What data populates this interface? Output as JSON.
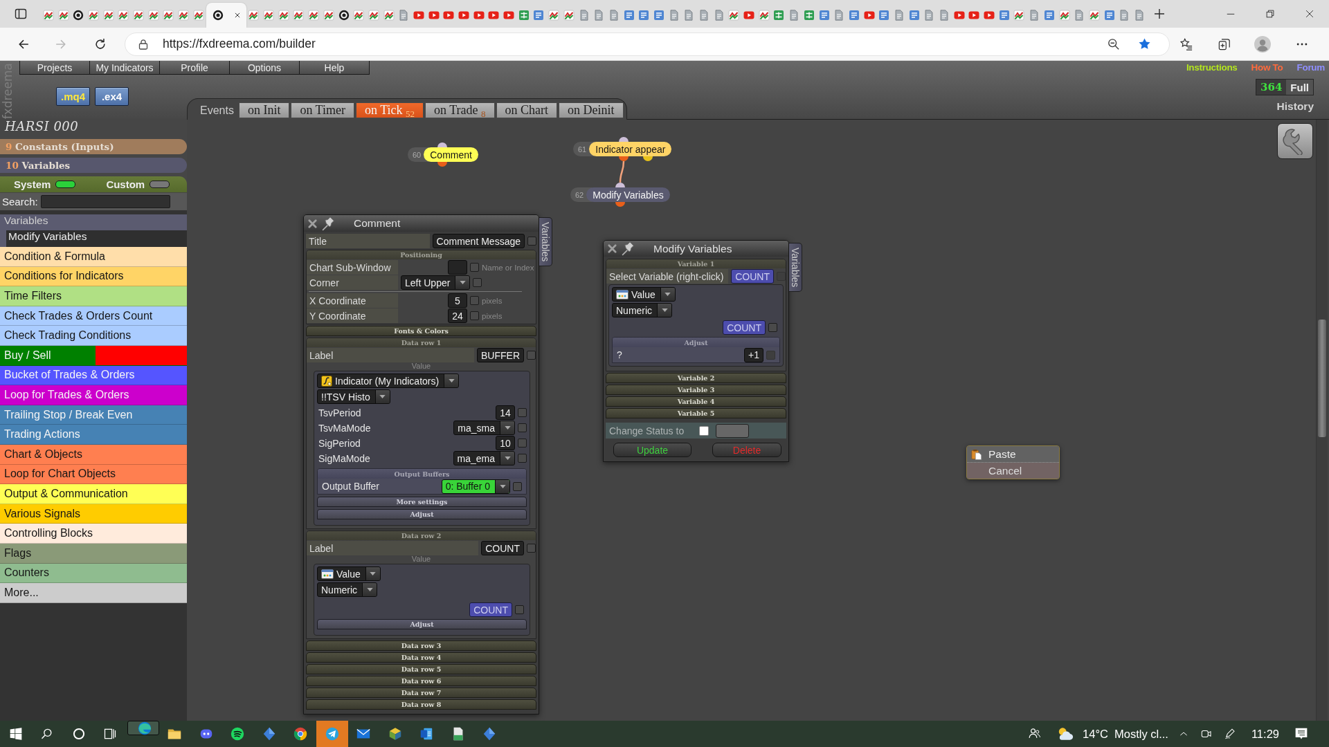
{
  "browser": {
    "tabs": [
      {
        "kind": "zigzag",
        "selected": false
      },
      {
        "kind": "zigzag",
        "selected": false
      },
      {
        "kind": "ring",
        "selected": false
      },
      {
        "kind": "zigzag",
        "selected": false
      },
      {
        "kind": "zigzag",
        "selected": false
      },
      {
        "kind": "zigzag",
        "selected": false
      },
      {
        "kind": "zigzag",
        "selected": false
      },
      {
        "kind": "zigzag",
        "selected": false
      },
      {
        "kind": "zigzag",
        "selected": false
      },
      {
        "kind": "zigzag",
        "selected": false
      },
      {
        "kind": "zigzag",
        "selected": false
      },
      {
        "kind": "ring",
        "selected": true
      },
      {
        "kind": "zigzag",
        "selected": false
      },
      {
        "kind": "zigzag",
        "selected": false
      },
      {
        "kind": "zigzag",
        "selected": false
      },
      {
        "kind": "zigzag",
        "selected": false
      },
      {
        "kind": "zigzag",
        "selected": false
      },
      {
        "kind": "zigzag",
        "selected": false
      },
      {
        "kind": "ring",
        "selected": false
      },
      {
        "kind": "zigzag",
        "selected": false
      },
      {
        "kind": "zigzag",
        "selected": false
      },
      {
        "kind": "zigzag",
        "selected": false
      },
      {
        "kind": "page",
        "selected": false
      },
      {
        "kind": "play",
        "selected": false
      },
      {
        "kind": "play",
        "selected": false
      },
      {
        "kind": "play",
        "selected": false
      },
      {
        "kind": "play",
        "selected": false
      },
      {
        "kind": "play",
        "selected": false
      },
      {
        "kind": "play",
        "selected": false
      },
      {
        "kind": "play",
        "selected": false
      },
      {
        "kind": "table",
        "selected": false
      },
      {
        "kind": "list",
        "selected": false
      },
      {
        "kind": "zigzag",
        "selected": false
      },
      {
        "kind": "zigzag",
        "selected": false
      },
      {
        "kind": "page",
        "selected": false
      },
      {
        "kind": "page",
        "selected": false
      },
      {
        "kind": "page",
        "selected": false
      },
      {
        "kind": "list",
        "selected": false
      },
      {
        "kind": "list",
        "selected": false
      },
      {
        "kind": "list",
        "selected": false
      },
      {
        "kind": "page",
        "selected": false
      },
      {
        "kind": "page",
        "selected": false
      },
      {
        "kind": "page",
        "selected": false
      },
      {
        "kind": "page",
        "selected": false
      },
      {
        "kind": "zigzag",
        "selected": false
      },
      {
        "kind": "play",
        "selected": false
      },
      {
        "kind": "zigzag",
        "selected": false
      },
      {
        "kind": "table",
        "selected": false
      },
      {
        "kind": "page",
        "selected": false
      },
      {
        "kind": "table",
        "selected": false
      },
      {
        "kind": "list",
        "selected": false
      },
      {
        "kind": "page",
        "selected": false
      },
      {
        "kind": "list",
        "selected": false
      },
      {
        "kind": "play",
        "selected": false
      },
      {
        "kind": "list",
        "selected": false
      },
      {
        "kind": "page",
        "selected": false
      },
      {
        "kind": "list",
        "selected": false
      },
      {
        "kind": "page",
        "selected": false
      },
      {
        "kind": "page",
        "selected": false
      },
      {
        "kind": "play",
        "selected": false
      },
      {
        "kind": "play",
        "selected": false
      },
      {
        "kind": "play",
        "selected": false
      },
      {
        "kind": "list",
        "selected": false
      },
      {
        "kind": "zigzag",
        "selected": false
      },
      {
        "kind": "page",
        "selected": false
      },
      {
        "kind": "list",
        "selected": false
      },
      {
        "kind": "zigzag",
        "selected": false
      },
      {
        "kind": "page",
        "selected": false
      },
      {
        "kind": "zigzag",
        "selected": false
      },
      {
        "kind": "list",
        "selected": false
      },
      {
        "kind": "page",
        "selected": false
      },
      {
        "kind": "page",
        "selected": false
      }
    ],
    "url": "https://fxdreema.com/builder",
    "bookmarked": true
  },
  "app": {
    "brand": "fxdreema",
    "menu": [
      "Projects",
      "My Indicators",
      "Profile",
      "Options",
      "Help"
    ],
    "file_buttons": [
      {
        "label": ".mq4",
        "selected": true
      },
      {
        "label": ".ex4",
        "selected": false
      }
    ],
    "links": [
      {
        "label": "Instructions",
        "color": "#b4e61e"
      },
      {
        "label": "How To",
        "color": "#ff6a3c"
      },
      {
        "label": "Forum",
        "color": "#8f8fff"
      }
    ],
    "history": {
      "count": "364",
      "mode": "Full",
      "label": "History"
    },
    "events": {
      "label": "Events",
      "tabs": [
        {
          "label": "on Init",
          "selected": false
        },
        {
          "label": "on Timer",
          "selected": false
        },
        {
          "label": "on Tick",
          "count": "52",
          "selected": true
        },
        {
          "label": "on Trade",
          "count": "8",
          "selected": false
        },
        {
          "label": "on Chart",
          "selected": false
        },
        {
          "label": "on Deinit",
          "selected": false
        }
      ]
    }
  },
  "sidebar": {
    "project": "HARSI 000",
    "groups": [
      {
        "count": "9",
        "label": "Constants (Inputs)",
        "color": "#a07c5c"
      },
      {
        "count": "10",
        "label": "Variables",
        "color": "#57576d"
      }
    ],
    "toggles": [
      {
        "label": "System",
        "on": true
      },
      {
        "label": "Custom",
        "on": false
      }
    ],
    "search": {
      "label": "Search:"
    },
    "section": "Variables",
    "section_items": [
      "Modify Variables"
    ],
    "categories": [
      {
        "label": "Condition & Formula",
        "color": "#ffdeaa"
      },
      {
        "label": "Conditions for Indicators",
        "color": "#ffd466"
      },
      {
        "label": "Time Filters",
        "color": "#b0e084"
      },
      {
        "label": "Check Trades & Orders Count",
        "color": "#aaccff"
      },
      {
        "label": "Check Trading Conditions",
        "color": "#aaccff"
      },
      {
        "label": "Buy / Sell",
        "color": "#008000",
        "split": {
          "color": "#ff0000"
        }
      },
      {
        "label": "Bucket of Trades & Orders",
        "color": "#5555ff"
      },
      {
        "label": "Loop for Trades & Orders",
        "color": "#cc00cc"
      },
      {
        "label": "Trailing Stop / Break Even",
        "color": "#4682b4"
      },
      {
        "label": "Trading Actions",
        "color": "#4682b4"
      },
      {
        "label": "Chart & Objects",
        "color": "#ff7f50"
      },
      {
        "label": "Loop for Chart Objects",
        "color": "#ff7f50"
      },
      {
        "label": "Output & Communication",
        "color": "#ffff55"
      },
      {
        "label": "Various Signals",
        "color": "#ffcc00"
      },
      {
        "label": "Controlling Blocks",
        "color": "#ffebdc"
      },
      {
        "label": "Flags",
        "color": "#8a9a78"
      },
      {
        "label": "Counters",
        "color": "#8fbc8f"
      },
      {
        "label": "More...",
        "color": "#cccccc"
      }
    ]
  },
  "canvas": {
    "nodes": [
      {
        "number": "60",
        "label": "Comment",
        "kind": "action",
        "color": "#ffff55"
      },
      {
        "number": "61",
        "label": "Indicator appear",
        "kind": "condition",
        "color": "#ffd466",
        "children": [
          {
            "number": "62",
            "label": "Modify Variables",
            "kind": "action",
            "color": "#5a5a70"
          }
        ]
      }
    ]
  },
  "comment_panel": {
    "title": "Comment",
    "side_tab": "Variables",
    "title_row": {
      "label": "Title",
      "value": "Comment Message",
      "checked": false
    },
    "sections": [
      {
        "kind": "positioning",
        "heading": "Positioning",
        "expanded": true,
        "groups": [
          [
            {
              "label": "Chart Sub-Window",
              "kind": "input",
              "note": "Name or Index",
              "checked": false
            },
            {
              "label": "Corner",
              "kind": "select",
              "value": "Left Upper",
              "checked": false
            }
          ],
          [
            {
              "label": "X Coordinate",
              "kind": "input",
              "value": "5",
              "note": "pixels",
              "checked": false
            },
            {
              "label": "Y Coordinate",
              "kind": "input",
              "value": "24",
              "note": "pixels",
              "checked": false
            }
          ]
        ]
      },
      {
        "kind": "fonts",
        "heading": "Fonts & Colors",
        "expanded": false
      },
      {
        "kind": "data_row",
        "heading": "Data row 1",
        "expanded": true,
        "label": {
          "name": "Label",
          "value": "BUFFER",
          "checked": false
        },
        "value_heading": "Value",
        "source": {
          "kind": "indicator",
          "type": "Indicator (My Indicators)",
          "name": "!!TSV Histo",
          "params": [
            {
              "label": "TsvPeriod",
              "kind": "input",
              "value": "14",
              "checked": false
            },
            {
              "label": "TsvMaMode",
              "kind": "select",
              "value": "ma_sma",
              "checked": false
            },
            {
              "label": "SigPeriod",
              "kind": "input",
              "value": "10",
              "checked": false
            },
            {
              "label": "SigMaMode",
              "kind": "select",
              "value": "ma_ema",
              "checked": false
            }
          ],
          "buffers": {
            "heading": "Output Buffers",
            "label": "Output Buffer",
            "value": "0: Buffer 0",
            "checked": false
          },
          "bars": [
            "More settings",
            "Adjust"
          ]
        }
      },
      {
        "kind": "data_row",
        "heading": "Data row 2",
        "expanded": true,
        "label": {
          "name": "Label",
          "value": "COUNT",
          "checked": false
        },
        "value_heading": "Value",
        "source": {
          "kind": "value",
          "type": "Value",
          "format": "Numeric",
          "variable": "COUNT",
          "checked": false,
          "bars": [
            "Adjust"
          ]
        }
      },
      {
        "kind": "data_row",
        "heading": "Data row 3",
        "expanded": false
      },
      {
        "kind": "data_row",
        "heading": "Data row 4",
        "expanded": false
      },
      {
        "kind": "data_row",
        "heading": "Data row 5",
        "expanded": false
      },
      {
        "kind": "data_row",
        "heading": "Data row 6",
        "expanded": false
      },
      {
        "kind": "data_row",
        "heading": "Data row 7",
        "expanded": false
      },
      {
        "kind": "data_row",
        "heading": "Data row 8",
        "expanded": false
      }
    ]
  },
  "modify_panel": {
    "title": "Modify Variables",
    "side_tab": "Variables",
    "variables": [
      {
        "heading": "Variable 1",
        "expanded": true,
        "select_label": "Select Variable (right-click)",
        "variable": {
          "value": "COUNT",
          "checked": false
        },
        "type": "Value",
        "format": "Numeric",
        "value": {
          "value": "COUNT",
          "checked": false
        },
        "adjust": {
          "heading": "Adjust",
          "label": "?",
          "value": "+1",
          "checked": false
        }
      },
      {
        "heading": "Variable 2",
        "expanded": false
      },
      {
        "heading": "Variable 3",
        "expanded": false
      },
      {
        "heading": "Variable 4",
        "expanded": false
      },
      {
        "heading": "Variable 5",
        "expanded": false
      }
    ],
    "status": {
      "label": "Change Status to",
      "checked": false
    },
    "buttons": [
      {
        "label": "Update",
        "kind": "update"
      },
      {
        "label": "Delete",
        "kind": "delete"
      }
    ]
  },
  "context_menu": [
    {
      "label": "Paste",
      "kind": "paste"
    },
    {
      "label": "Cancel",
      "kind": "cancel"
    }
  ],
  "taskbar": {
    "system_buttons": [
      {
        "kind": "start"
      },
      {
        "kind": "search"
      },
      {
        "kind": "assistant"
      },
      {
        "kind": "task_view"
      }
    ],
    "apps": [
      {
        "kind": "swirl",
        "selected": true,
        "attention": false
      },
      {
        "kind": "folder",
        "selected": false,
        "attention": false
      },
      {
        "kind": "chat",
        "selected": false,
        "attention": false
      },
      {
        "kind": "waves",
        "selected": false,
        "attention": false
      },
      {
        "kind": "diamond",
        "selected": false,
        "attention": false
      },
      {
        "kind": "tricolor",
        "selected": false,
        "attention": false
      },
      {
        "kind": "plane",
        "selected": false,
        "attention": true
      },
      {
        "kind": "envelope",
        "selected": false,
        "attention": false
      },
      {
        "kind": "cube",
        "selected": false,
        "attention": false
      },
      {
        "kind": "document",
        "selected": false,
        "attention": false
      },
      {
        "kind": "file",
        "selected": false,
        "attention": false
      },
      {
        "kind": "diamond",
        "selected": false,
        "attention": false
      }
    ],
    "weather": {
      "temperature": "14°C",
      "summary": "Mostly cl..."
    },
    "clock": "11:29"
  }
}
